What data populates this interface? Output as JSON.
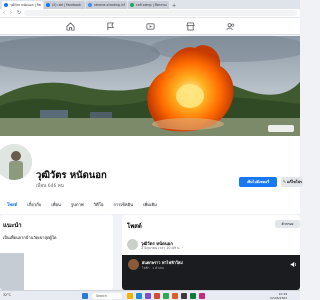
{
  "browser": {
    "tabs": [
      {
        "title": "วุฒิวัตร หนัดนอก | Facebook"
      },
      {
        "title": "(5) เฟส | Facebook"
      },
      {
        "title": "xtreme-xtrading.info - Searc"
      },
      {
        "title": "cofi.camp | ทีศกรรมแอนทีโน"
      }
    ],
    "new_tab_label": "+"
  },
  "profile": {
    "name": "วุฒิวัตร หนัดนอก",
    "friends": "เพื่อน 646 คน",
    "add_story_label": "เพิ่มไปยังสตอรี่",
    "edit_profile_label": "แก้ไขโปร"
  },
  "tabs": [
    "โพสต์",
    "เกี่ยวกับ",
    "เพื่อน",
    "รูปภาพ",
    "วิดีโอ",
    "การเช็คอิน",
    "เพิ่มเติม"
  ],
  "intro": {
    "title": "แนะนำ",
    "line": "เป็นเพื่อนจากบ้านวัดเขาสุดผู้ใด"
  },
  "posts": {
    "title": "โพสต์",
    "filter_label": "ตัวกรอง",
    "author": "วุฒิวัตร หนัดนอก",
    "meta": "2 มิถุนายน เวลา 10:49 น. ·",
    "audio_title": "ฝนตกพราว ฟาไฟฟ้าใหม่",
    "audio_sub": "ไฟฟ้า · 1 ตัวเล่น"
  },
  "taskbar": {
    "weather": "32°C",
    "search_label": "Search",
    "time": "10:49",
    "date": "02/06/2567"
  },
  "colors": {
    "brand": "#1877f2",
    "page_bg": "#f0f2f5",
    "fire": "#ff6a00"
  },
  "icons": [
    "home-icon",
    "flag-icon",
    "video-icon",
    "store-icon",
    "people-icon",
    "search-icon",
    "pencil-icon",
    "volume-icon"
  ]
}
